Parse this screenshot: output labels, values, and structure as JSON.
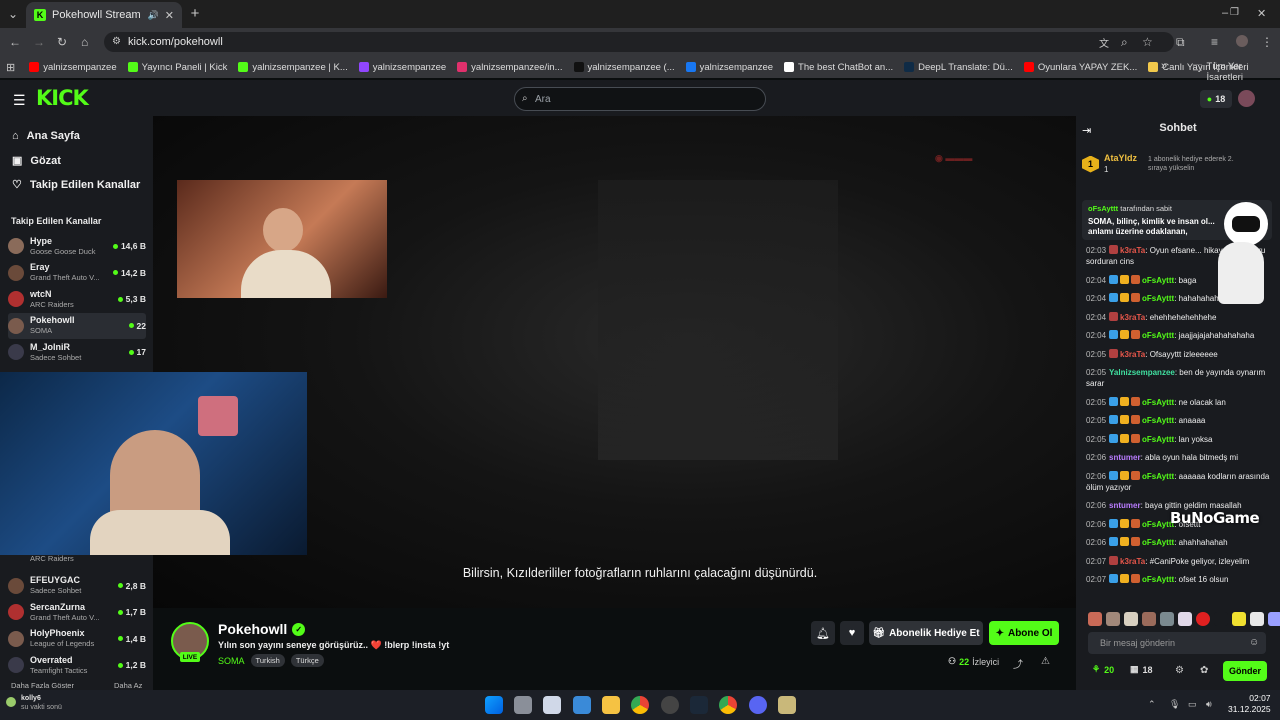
{
  "browser": {
    "tab_title": "Pokehowll Stream - Watch L",
    "url": "kick.com/pokehowll",
    "bookmarks": [
      {
        "label": "yalnizsempanzee",
        "color": "#ff0000"
      },
      {
        "label": "Yayıncı Paneli | Kick",
        "color": "#53fc18"
      },
      {
        "label": "yalnizsempanzee | K...",
        "color": "#53fc18"
      },
      {
        "label": "yalnizsempanzee",
        "color": "#9146ff"
      },
      {
        "label": "yalnizsempanzee/in...",
        "color": "#e1306c"
      },
      {
        "label": "yalnizsempanzee (...",
        "color": "#111111"
      },
      {
        "label": "yalnizsempanzee",
        "color": "#1877f2"
      },
      {
        "label": "The best ChatBot an...",
        "color": "#ffffff"
      },
      {
        "label": "DeepL Translate: Dü...",
        "color": "#0f2b46"
      },
      {
        "label": "Oyunlara YAPAY ZEK...",
        "color": "#ff0000"
      },
      {
        "label": "Canlı Yayın İçerikleri",
        "color": "#f2c94c"
      }
    ],
    "all_bookmarks": "Tüm Yer İşaretleri"
  },
  "header": {
    "logo": "KICK",
    "search_placeholder": "Ara",
    "points": "18"
  },
  "sidebar": {
    "nav": [
      {
        "label": "Ana Sayfa",
        "icon": "home-icon"
      },
      {
        "label": "Gözat",
        "icon": "browse-icon"
      },
      {
        "label": "Takip Edilen Kanallar",
        "icon": "heart-icon"
      }
    ],
    "following_header": "Takip Edilen Kanallar",
    "channels_top": [
      {
        "name": "Hype",
        "game": "Goose Goose Duck",
        "viewers": "14,6 B"
      },
      {
        "name": "Eray",
        "game": "Grand Theft Auto V...",
        "viewers": "14,2 B"
      },
      {
        "name": "wtcN",
        "game": "ARC Raiders",
        "viewers": "5,3 B"
      },
      {
        "name": "Pokehowll",
        "game": "SOMA",
        "viewers": "22"
      },
      {
        "name": "M_JolniR",
        "game": "Sadece Sohbet",
        "viewers": "17"
      }
    ],
    "channels_bottom": [
      {
        "name": "",
        "game": "ARC Raiders",
        "viewers": ""
      },
      {
        "name": "EFEUYGAC",
        "game": "Sadece Sohbet",
        "viewers": "2,8 B"
      },
      {
        "name": "SercanZurna",
        "game": "Grand Theft Auto V...",
        "viewers": "1,7 B"
      },
      {
        "name": "HolyPhoenix",
        "game": "League of Legends",
        "viewers": "1,4 B"
      },
      {
        "name": "Overrated",
        "game": "Teamfight Tactics",
        "viewers": "1,2 B"
      }
    ],
    "show_more": "Daha Fazla Göster",
    "show_less": "Daha Az"
  },
  "video": {
    "subtitle": "Bilirsin, Kızılderililer fotoğrafların ruhlarını çalacağını düşünürdü."
  },
  "stream": {
    "name": "Pokehowll",
    "title": "Yılın son yayını seneye görüşürüz.. ❤️ !blerp !insta !yt",
    "category": "SOMA",
    "tags": [
      "Turkish",
      "Türkçe"
    ],
    "live_label": "LIVE",
    "gift_label": "Abonelik Hediye Et",
    "subscribe_label": "Abone Ol",
    "viewers": "22",
    "viewers_label": "İzleyici"
  },
  "chat": {
    "title": "Sohbet",
    "top_gifter": {
      "name": "AtaYldz",
      "count": "1",
      "rank": "1",
      "text": "1 abonelik hediye ederek 2. sıraya yükselin"
    },
    "pinned_text": "SOMA, bilinç, kimlik ve insan ol... anlamı üzerine odaklanan,",
    "pinned_by": "oFsAyttt",
    "pinned_suffix": "tarafından sabit",
    "messages": [
      {
        "time": "02:03",
        "user": "k3raTa",
        "color": "#e8574b",
        "text": "Oyun efsane... hikayesi çok soru sorduran cins"
      },
      {
        "time": "02:04",
        "user": "oFsAyttt",
        "color": "#53fc18",
        "text": "baga"
      },
      {
        "time": "02:04",
        "user": "oFsAyttt",
        "color": "#53fc18",
        "text": "hahahahahahahaha"
      },
      {
        "time": "02:04",
        "user": "k3raTa",
        "color": "#e8574b",
        "text": "ehehhehehehhehe"
      },
      {
        "time": "02:04",
        "user": "oFsAyttt",
        "color": "#53fc18",
        "text": "jaajjajajahahahahaha"
      },
      {
        "time": "02:05",
        "user": "k3raTa",
        "color": "#e8574b",
        "text": "Ofsayyttt izleeeeee"
      },
      {
        "time": "02:05",
        "user": "Yalnizsempanzee",
        "color": "#40e0a0",
        "text": "ben de yayında oynarım sarar"
      },
      {
        "time": "02:05",
        "user": "oFsAyttt",
        "color": "#53fc18",
        "text": "ne olacak lan"
      },
      {
        "time": "02:05",
        "user": "oFsAyttt",
        "color": "#53fc18",
        "text": "anaaaa"
      },
      {
        "time": "02:05",
        "user": "oFsAyttt",
        "color": "#53fc18",
        "text": "lan yoksa"
      },
      {
        "time": "02:06",
        "user": "sntumer",
        "color": "#b97cff",
        "text": "abla oyun hala bitmedş mi"
      },
      {
        "time": "02:06",
        "user": "oFsAyttt",
        "color": "#53fc18",
        "text": "aaaaaa kodların arasında ölüm yazıyor"
      },
      {
        "time": "02:06",
        "user": "sntumer",
        "color": "#b97cff",
        "text": "baya gittin geldim masallah"
      },
      {
        "time": "02:06",
        "user": "oFsAyttt",
        "color": "#53fc18",
        "text": "ofsettt"
      },
      {
        "time": "02:06",
        "user": "oFsAyttt",
        "color": "#53fc18",
        "text": "ahahhahahah"
      },
      {
        "time": "02:07",
        "user": "k3raTa",
        "color": "#e8574b",
        "text": "#CaniPoke geliyor, izleyelim"
      },
      {
        "time": "02:07",
        "user": "oFsAyttt",
        "color": "#53fc18",
        "text": "ofset 16 olsun"
      }
    ],
    "input_placeholder": "Bir mesaj gönderin",
    "send_label": "Gönder",
    "points": "20",
    "subs": "18",
    "overlay_text": "BuNoGame"
  },
  "taskbar": {
    "user": "kolly6",
    "status": "su vakti sonü",
    "time": "02:07",
    "date": "31.12.2025"
  }
}
